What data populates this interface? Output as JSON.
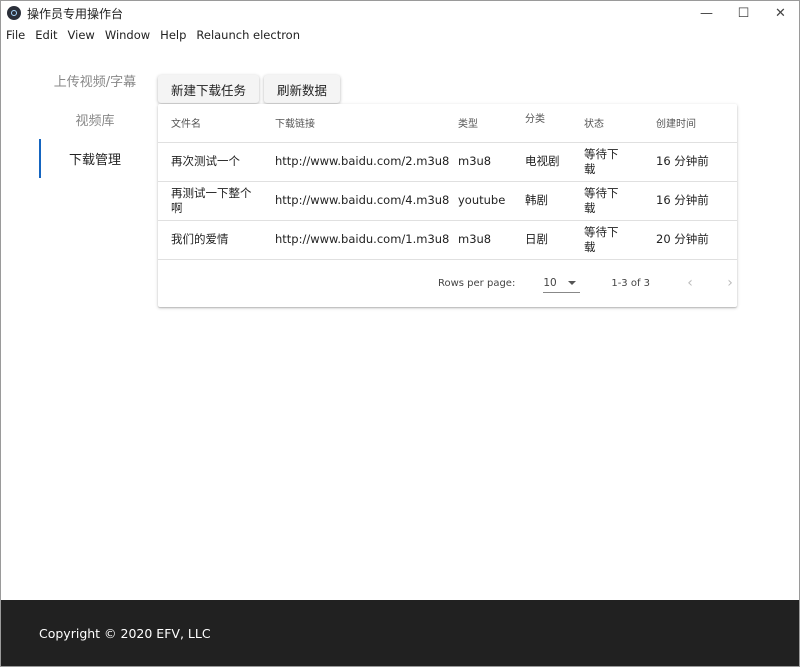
{
  "window": {
    "title": "操作员专用操作台",
    "controls": {
      "minimize": "—",
      "maximize": "☐",
      "close": "✕"
    }
  },
  "menu": [
    "File",
    "Edit",
    "View",
    "Window",
    "Help",
    "Relaunch electron"
  ],
  "sidebar": {
    "items": [
      {
        "label": "上传视频/字幕",
        "active": false
      },
      {
        "label": "视频库",
        "active": false
      },
      {
        "label": "下载管理",
        "active": true
      }
    ]
  },
  "toolbar": {
    "new_task_label": "新建下载任务",
    "refresh_label": "刷新数据"
  },
  "table": {
    "headers": [
      "文件名",
      "下载链接",
      "类型",
      "分类",
      "状态",
      "创建时间"
    ],
    "rows": [
      [
        "再次测试一个",
        "http://www.baidu.com/2.m3u8",
        "m3u8",
        "电视剧",
        "等待下载",
        "16 分钟前"
      ],
      [
        "再测试一下整个啊",
        "http://www.baidu.com/4.m3u8",
        "youtube",
        "韩剧",
        "等待下载",
        "16 分钟前"
      ],
      [
        "我们的爱情",
        "http://www.baidu.com/1.m3u8",
        "m3u8",
        "日剧",
        "等待下载",
        "20 分钟前"
      ]
    ]
  },
  "pagination": {
    "rows_per_page_label": "Rows per page:",
    "rows_per_page_value": "10",
    "range_text": "1-3 of 3",
    "prev_icon": "‹",
    "next_icon": "›"
  },
  "footer": {
    "copyright": "Copyright © 2020 EFV, LLC"
  }
}
